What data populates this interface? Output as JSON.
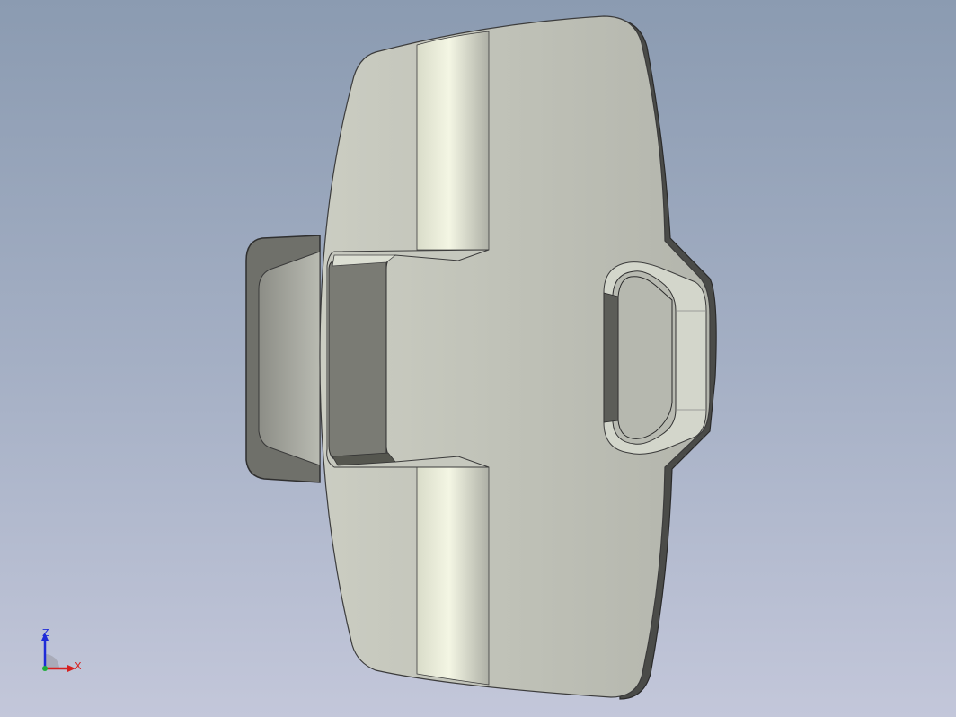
{
  "viewport": {
    "background_top": "#8b9bb1",
    "background_bottom": "#c3c7da"
  },
  "model": {
    "part": "plate-with-handle",
    "face_color": "#b8bab1",
    "face_light": "#cdd0c5",
    "edge_color": "#3c3c3c",
    "shadow_color": "#6e6f69"
  },
  "triad": {
    "z_label": "Z",
    "x_label": "X",
    "z_color": "#1f2bd8",
    "x_color": "#d62020",
    "origin_color": "#1fae3a"
  }
}
